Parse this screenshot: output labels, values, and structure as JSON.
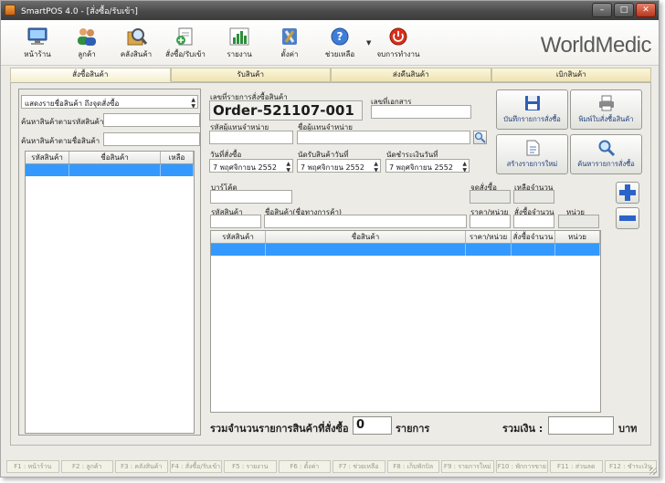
{
  "window": {
    "title": "SmartPOS 4.0 - [สั่งซื้อ/รับเข้า]",
    "minimize": "–",
    "maximize": "□",
    "close": "✕"
  },
  "toolbar": {
    "items": [
      {
        "label": "หน้าร้าน",
        "icon": "monitor-icon"
      },
      {
        "label": "ลูกค้า",
        "icon": "users-icon"
      },
      {
        "label": "คลังสินค้า",
        "icon": "warehouse-search-icon"
      },
      {
        "label": "สั่งซื้อ/รับเข้า",
        "icon": "purchase-icon"
      },
      {
        "label": "รายงาน",
        "icon": "bar-chart-icon"
      },
      {
        "label": "ตั้งค่า",
        "icon": "tools-icon"
      },
      {
        "label": "ช่วยเหลือ",
        "icon": "help-icon"
      },
      {
        "label": "จบการทำงาน",
        "icon": "power-icon"
      }
    ],
    "logo": "WorldMedic"
  },
  "tabs": [
    "สั่งซื้อสินค้า",
    "รับสินค้า",
    "ส่งคืนสินค้า",
    "เบิกสินค้า"
  ],
  "left_panel": {
    "display_label": "แสดงรายชื่อสินค้า ถึงจุดสั่งซื้อ",
    "search_code_label": "ค้นหาสินค้าตามรหัสสินค้า",
    "search_code_value": "",
    "search_name_label": "ค้นหาสินค้าตามชื่อสินค้า",
    "search_name_value": "",
    "columns": [
      "รหัสสินค้า",
      "ชื่อสินค้า",
      "เหลือ"
    ]
  },
  "order": {
    "number_label": "เลขที่รายการสั่งซื้อสินค้า",
    "number": "Order-521107-001",
    "doc_label": "เลขที่เอกสาร",
    "doc_value": "",
    "supplier_code_label": "รหัสผู้แทนจำหน่าย",
    "supplier_code_value": "",
    "supplier_name_label": "ชื่อผู้แทนจำหน่าย",
    "supplier_name_value": "",
    "order_date_label": "วันที่สั่งซื้อ",
    "order_date": "7 พฤศจิกายน  2552",
    "receive_date_label": "นัดรับสินค้าวันที่",
    "receive_date": "7 พฤศจิกายน  2552",
    "pay_date_label": "นัดชำระเงินวันที่",
    "pay_date": "7 พฤศจิกายน  2552"
  },
  "actions": {
    "save": "บันทึกรายการสั่งซื้อ",
    "print": "พิมพ์ใบสั่งซื้อสินค้า",
    "new": "สร้างรายการใหม่",
    "find": "ค้นหารายการสั่งซื้อ"
  },
  "item_entry": {
    "barcode_label": "บาร์โค้ด",
    "barcode_value": "",
    "reorder_label": "จุดสั่งซื้อ",
    "reorder_value": "",
    "remaining_label": "เหลือจำนวน",
    "remaining_value": "",
    "code_label": "รหัสสินค้า",
    "code_value": "",
    "name_label": "ชื่อสินค้า(ชื่อทางการค้า)",
    "name_value": "",
    "price_label": "ราคา/หน่วย",
    "price_value": "",
    "qty_label": "สั่งซื้อจำนวน",
    "qty_value": "",
    "unit_label": "หน่วย",
    "unit_value": ""
  },
  "items_grid": {
    "columns": [
      "รหัสสินค้า",
      "ชื่อสินค้า",
      "ราคา/หน่วย",
      "สั่งซื้อจำนวน",
      "หน่วย"
    ]
  },
  "footer": {
    "count_label": "รวมจำนวนรายการสินค้าที่สั่งซื้อ :",
    "count_value": "0",
    "count_unit": "รายการ",
    "sum_label": "รวมเงิน :",
    "sum_value": "",
    "sum_unit": "บาท"
  },
  "fkeys": [
    "F1 : หน้าร้าน",
    "F2 : ลูกค้า",
    "F3 : คลังสินค้า",
    "F4 : สั่งซื้อ/รับเข้า",
    "F5 : รายงาน",
    "F6 : ตั้งค่า",
    "F7 : ช่วยเหลือ",
    "F8 : เก็บพักบิล",
    "F9 : รายการใหม่",
    "F10 : พักการขาย",
    "F11 : ส่วนลด",
    "F12 : ชำระเงิน"
  ],
  "colors": {
    "selection": "#3399ff",
    "tab": "#efe4b2",
    "accent_blue": "#1d5fc2"
  }
}
